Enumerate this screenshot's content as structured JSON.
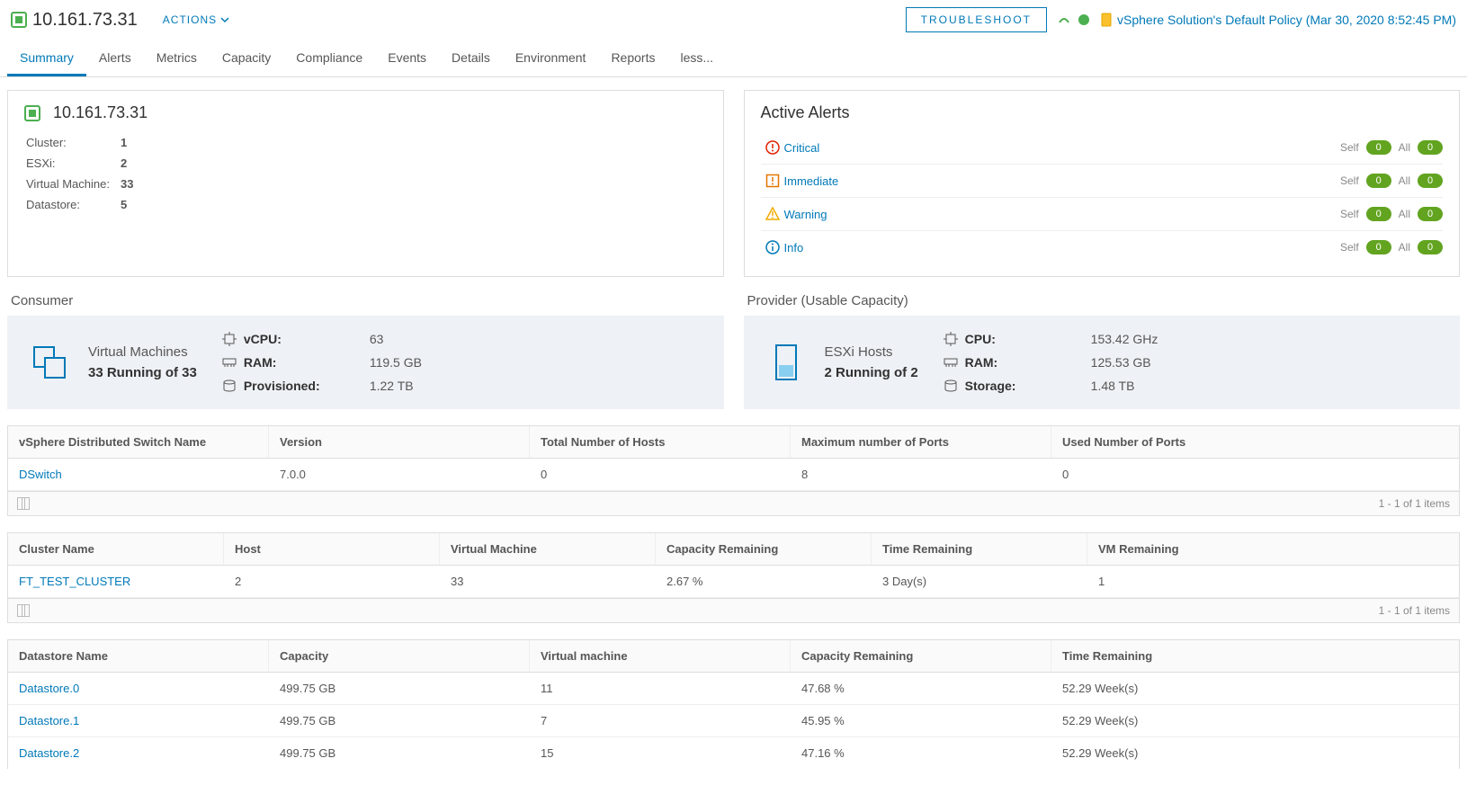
{
  "header": {
    "title": "10.161.73.31",
    "actions_label": "ACTIONS",
    "troubleshoot_label": "TROUBLESHOOT",
    "policy_text": "vSphere Solution's Default Policy (Mar 30, 2020 8:52:45 PM)"
  },
  "tabs": {
    "summary": "Summary",
    "alerts": "Alerts",
    "metrics": "Metrics",
    "capacity": "Capacity",
    "compliance": "Compliance",
    "events": "Events",
    "details": "Details",
    "environment": "Environment",
    "reports": "Reports",
    "less": "less..."
  },
  "summary_card": {
    "title": "10.161.73.31",
    "rows": {
      "cluster_label": "Cluster:",
      "cluster_value": "1",
      "esxi_label": "ESXi:",
      "esxi_value": "2",
      "vm_label": "Virtual Machine:",
      "vm_value": "33",
      "ds_label": "Datastore:",
      "ds_value": "5"
    }
  },
  "alerts_card": {
    "title": "Active Alerts",
    "self_label": "Self",
    "all_label": "All",
    "rows": {
      "critical": {
        "label": "Critical",
        "self": "0",
        "all": "0"
      },
      "immediate": {
        "label": "Immediate",
        "self": "0",
        "all": "0"
      },
      "warning": {
        "label": "Warning",
        "self": "0",
        "all": "0"
      },
      "info": {
        "label": "Info",
        "self": "0",
        "all": "0"
      }
    }
  },
  "consumer": {
    "section": "Consumer",
    "title": "Virtual Machines",
    "subtitle": "33 Running of 33",
    "metrics": {
      "vcpu_label": "vCPU:",
      "vcpu_value": "63",
      "ram_label": "RAM:",
      "ram_value": "119.5 GB",
      "prov_label": "Provisioned:",
      "prov_value": "1.22 TB"
    }
  },
  "provider": {
    "section": "Provider (Usable Capacity)",
    "title": "ESXi Hosts",
    "subtitle": "2 Running of 2",
    "metrics": {
      "cpu_label": "CPU:",
      "cpu_value": "153.42 GHz",
      "ram_label": "RAM:",
      "ram_value": "125.53 GB",
      "storage_label": "Storage:",
      "storage_value": "1.48 TB"
    }
  },
  "table_switch": {
    "headers": {
      "c1": "vSphere Distributed Switch Name",
      "c2": "Version",
      "c3": "Total Number of Hosts",
      "c4": "Maximum number of Ports",
      "c5": "Used Number of Ports"
    },
    "rows": [
      {
        "c1": "DSwitch",
        "c2": "7.0.0",
        "c3": "0",
        "c4": "8",
        "c5": "0"
      }
    ],
    "footer": "1 - 1 of 1 items"
  },
  "table_cluster": {
    "headers": {
      "c1": "Cluster Name",
      "c2": "Host",
      "c3": "Virtual Machine",
      "c4": "Capacity Remaining",
      "c5": "Time Remaining",
      "c6": "VM Remaining"
    },
    "rows": [
      {
        "c1": "FT_TEST_CLUSTER",
        "c2": "2",
        "c3": "33",
        "c4": "2.67 %",
        "c5": "3 Day(s)",
        "c6": "1"
      }
    ],
    "footer": "1 - 1 of 1 items"
  },
  "table_datastore": {
    "headers": {
      "c1": "Datastore Name",
      "c2": "Capacity",
      "c3": "Virtual machine",
      "c4": "Capacity Remaining",
      "c5": "Time Remaining"
    },
    "rows": [
      {
        "c1": "Datastore.0",
        "c2": "499.75 GB",
        "c3": "11",
        "c4": "47.68 %",
        "c5": "52.29 Week(s)"
      },
      {
        "c1": "Datastore.1",
        "c2": "499.75 GB",
        "c3": "7",
        "c4": "45.95 %",
        "c5": "52.29 Week(s)"
      },
      {
        "c1": "Datastore.2",
        "c2": "499.75 GB",
        "c3": "15",
        "c4": "47.16 %",
        "c5": "52.29 Week(s)"
      }
    ]
  }
}
